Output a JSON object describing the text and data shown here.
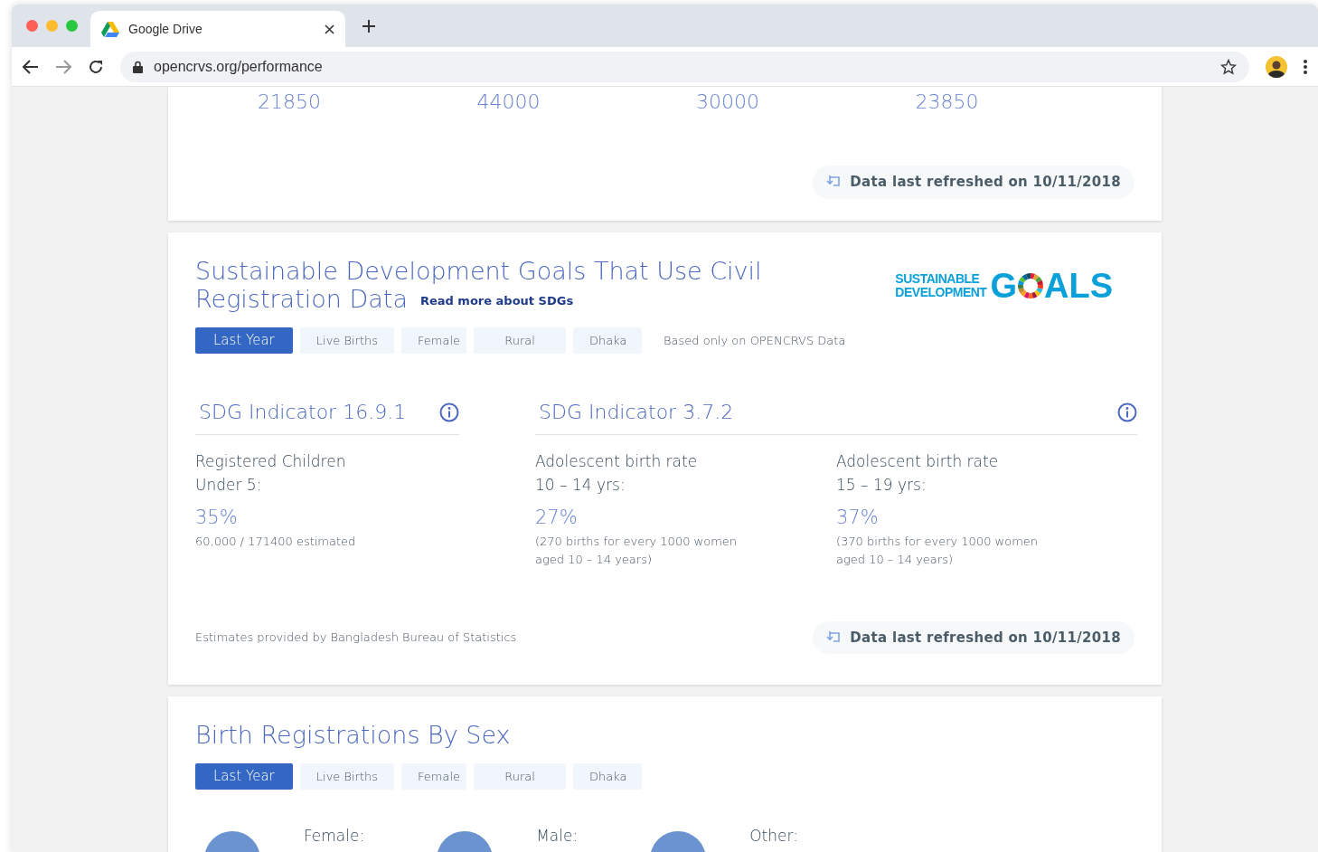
{
  "browser": {
    "tab_title": "Google Drive",
    "url": "opencrvs.org/performance"
  },
  "summary_card": {
    "values": [
      "21850",
      "44000",
      "30000",
      "23850"
    ],
    "refreshed": "Data last refreshed on 10/11/2018"
  },
  "sdg_card": {
    "title_lines": [
      "Sustainable Development Goals That Use Civil",
      "Registration Data"
    ],
    "link": "Read more about SDGs",
    "logo": {
      "line1": "SUSTAINABLE",
      "line2": "DEVELOPMENT",
      "word_start": "G",
      "word_end": "ALS"
    },
    "filters": [
      {
        "label": "Last Year",
        "selected": true
      },
      {
        "label": "Live Births",
        "selected": false
      },
      {
        "label": "Female",
        "selected": false
      },
      {
        "label": "Rural",
        "selected": false
      },
      {
        "label": "Dhaka",
        "selected": false
      }
    ],
    "filter_note": "Based only on OPENCRVS Data",
    "indicators": [
      {
        "title": "SDG Indicator 16.9.1",
        "metrics": [
          {
            "label": "Registered Children Under 5:",
            "value": "35%",
            "detail": "60,000 / 171400 estimated"
          }
        ]
      },
      {
        "title": "SDG Indicator 3.7.2",
        "metrics": [
          {
            "label": "Adolescent birth rate 10 – 14 yrs:",
            "value": "27%",
            "detail": "(270 births for every 1000 women aged 10 – 14 years)"
          },
          {
            "label": "Adolescent birth rate 15 – 19 yrs:",
            "value": "37%",
            "detail": "(370 births for every 1000 women aged 10 – 14 years)"
          }
        ]
      }
    ],
    "source": "Estimates provided by Bangladesh Bureau of Statistics",
    "refreshed": "Data last refreshed on 10/11/2018"
  },
  "sex_card": {
    "title": "Birth Registrations By Sex",
    "filters": [
      {
        "label": "Last Year",
        "selected": true
      },
      {
        "label": "Live Births",
        "selected": false
      },
      {
        "label": "Female",
        "selected": false
      },
      {
        "label": "Rural",
        "selected": false
      },
      {
        "label": "Dhaka",
        "selected": false
      }
    ],
    "legend": [
      "Female:",
      "Male:",
      "Other:"
    ]
  }
}
